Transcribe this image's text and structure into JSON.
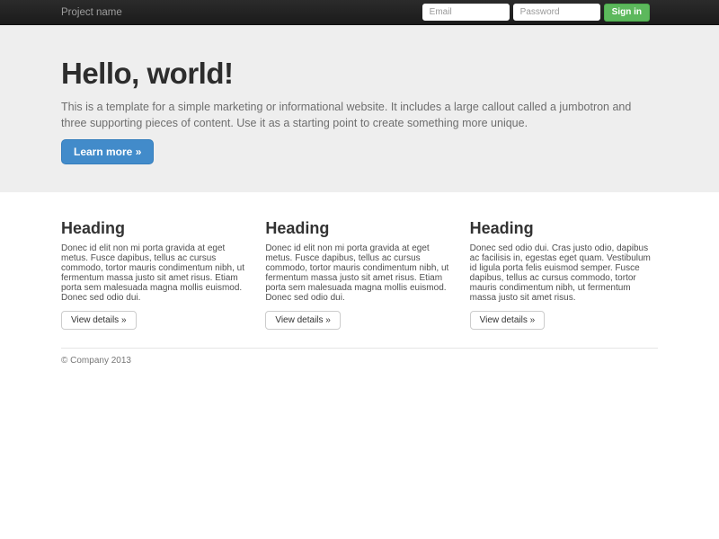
{
  "navbar": {
    "brand": "Project name",
    "email_placeholder": "Email",
    "password_placeholder": "Password",
    "sign_in_label": "Sign in"
  },
  "jumbotron": {
    "title": "Hello, world!",
    "description": "This is a template for a simple marketing or informational website. It includes a large callout called a jumbotron and three supporting pieces of content. Use it as a starting point to create something more unique.",
    "cta_label": "Learn more »"
  },
  "columns": [
    {
      "heading": "Heading",
      "body": "Donec id elit non mi porta gravida at eget metus. Fusce dapibus, tellus ac cursus commodo, tortor mauris condimentum nibh, ut fermentum massa justo sit amet risus. Etiam porta sem malesuada magna mollis euismod. Donec sed odio dui.",
      "button_label": "View details »"
    },
    {
      "heading": "Heading",
      "body": "Donec id elit non mi porta gravida at eget metus. Fusce dapibus, tellus ac cursus commodo, tortor mauris condimentum nibh, ut fermentum massa justo sit amet risus. Etiam porta sem malesuada magna mollis euismod. Donec sed odio dui.",
      "button_label": "View details »"
    },
    {
      "heading": "Heading",
      "body": "Donec sed odio dui. Cras justo odio, dapibus ac facilisis in, egestas eget quam. Vestibulum id ligula porta felis euismod semper. Fusce dapibus, tellus ac cursus commodo, tortor mauris condimentum nibh, ut fermentum massa justo sit amet risus.",
      "button_label": "View details »"
    }
  ],
  "footer": {
    "copyright": "© Company 2013"
  },
  "colors": {
    "navbar_bg": "#222222",
    "navbar_brand_text": "#9d9d9d",
    "jumbotron_bg": "#eeeeee",
    "primary_button_bg": "#428bca",
    "primary_button_border": "#357ebd",
    "signin_button_bg": "#5cb85c",
    "signin_button_border": "#4cae4c"
  }
}
